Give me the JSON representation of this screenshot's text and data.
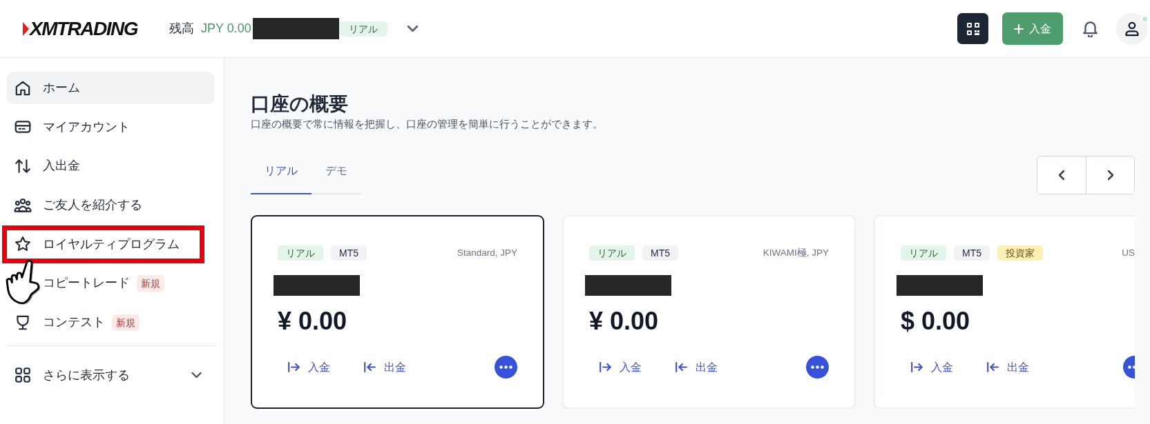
{
  "header": {
    "logo": "XMTRADING",
    "balance_label": "残高",
    "balance": "JPY 0.00",
    "account_badge": "リアル",
    "deposit_button": "入金",
    "user_online": true
  },
  "sidebar": {
    "items": [
      {
        "label": "ホーム",
        "selected": true,
        "highlighted": false
      },
      {
        "label": "マイアカウント",
        "selected": false,
        "highlighted": false
      },
      {
        "label": "入出金",
        "selected": false,
        "highlighted": false
      },
      {
        "label": "ご友人を紹介する",
        "selected": false,
        "highlighted": false
      },
      {
        "label": "ロイヤルティプログラム",
        "selected": false,
        "highlighted": true
      },
      {
        "label": "コピートレード",
        "selected": false,
        "highlighted": false,
        "badge": "新規"
      },
      {
        "label": "コンテスト",
        "selected": false,
        "highlighted": false,
        "badge": "新規"
      }
    ],
    "more": {
      "label": "さらに表示する",
      "expanded": false
    }
  },
  "overview": {
    "title": "口座の概要",
    "subtitle": "口座の概要で常に情報を把握し、口座の管理を簡単に行うことができます。",
    "tabs": [
      {
        "label": "リアル",
        "selected": true
      },
      {
        "label": "デモ",
        "selected": false
      }
    ]
  },
  "accounts": [
    {
      "selected": true,
      "tags": [
        {
          "kind": "real",
          "text": "リアル"
        },
        {
          "kind": "platform",
          "text": "MT5"
        }
      ],
      "type": "Standard, JPY",
      "balance": "¥ 0.00",
      "actions": [
        {
          "kind": "deposit",
          "label": "入金"
        },
        {
          "kind": "withdraw",
          "label": "出金"
        }
      ]
    },
    {
      "selected": false,
      "tags": [
        {
          "kind": "real",
          "text": "リアル"
        },
        {
          "kind": "platform",
          "text": "MT5"
        }
      ],
      "type": "KIWAMI極, JPY",
      "balance": "¥ 0.00",
      "actions": [
        {
          "kind": "deposit",
          "label": "入金"
        },
        {
          "kind": "withdraw",
          "label": "出金"
        }
      ]
    },
    {
      "selected": false,
      "tags": [
        {
          "kind": "real",
          "text": "リアル"
        },
        {
          "kind": "platform",
          "text": "MT5"
        },
        {
          "kind": "investor",
          "text": "投資家"
        }
      ],
      "type": "US",
      "balance": "$ 0.00",
      "actions": [
        {
          "kind": "deposit",
          "label": "入金"
        },
        {
          "kind": "withdraw",
          "label": "出金"
        }
      ]
    }
  ]
}
